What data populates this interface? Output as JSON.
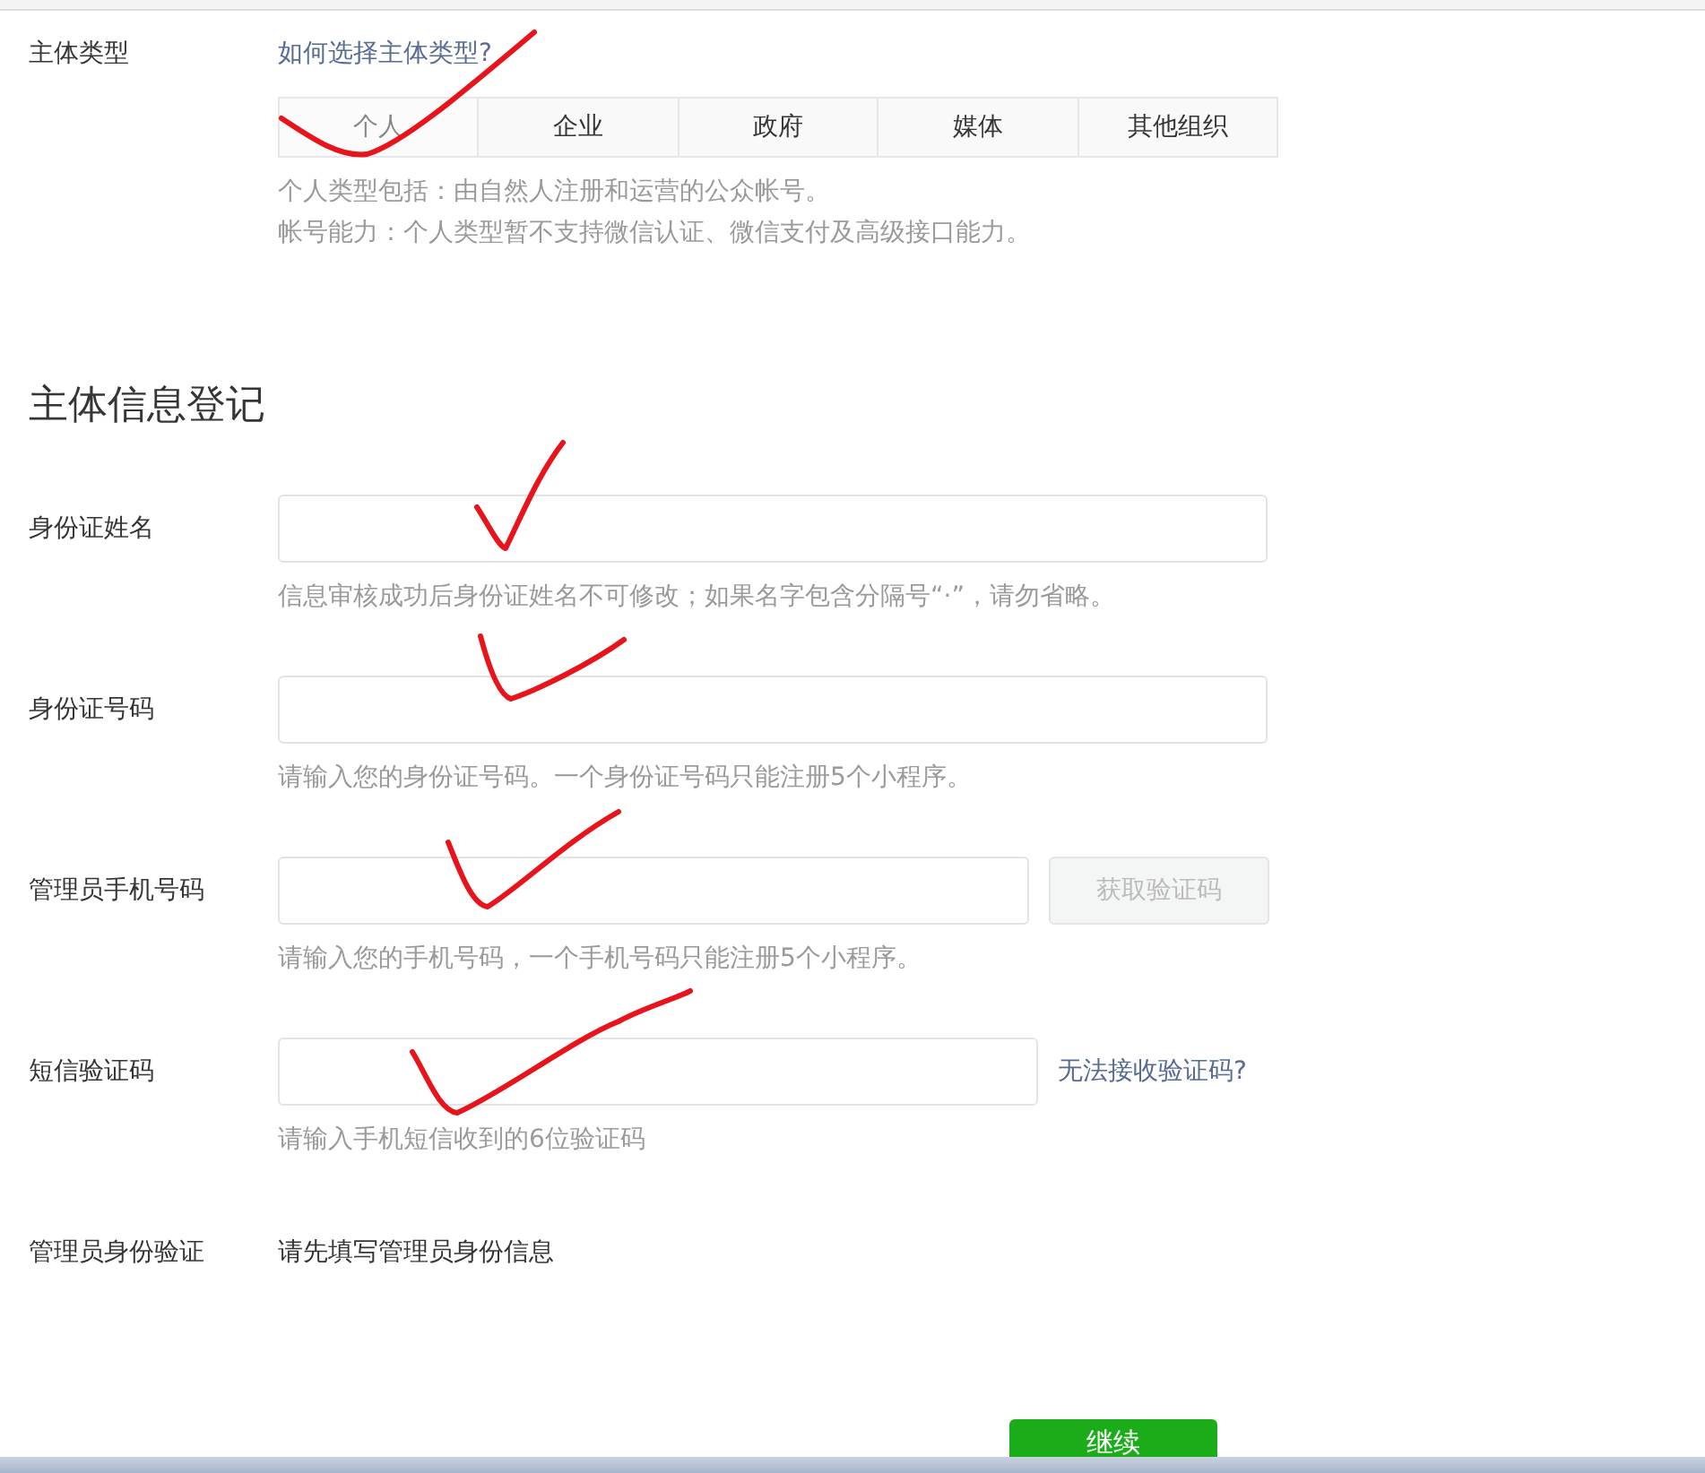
{
  "subject_type": {
    "label": "主体类型",
    "help_link": "如何选择主体类型?",
    "tabs": [
      {
        "label": "个人",
        "selected": true
      },
      {
        "label": "企业",
        "selected": false
      },
      {
        "label": "政府",
        "selected": false
      },
      {
        "label": "媒体",
        "selected": false
      },
      {
        "label": "其他组织",
        "selected": false
      }
    ],
    "notes": [
      "个人类型包括：由自然人注册和运营的公众帐号。",
      "帐号能力：个人类型暂不支持微信认证、微信支付及高级接口能力。"
    ]
  },
  "section_title": "主体信息登记",
  "fields": [
    {
      "kind": "input",
      "label": "身份证姓名",
      "help": "信息审核成功后身份证姓名不可修改；如果名字包含分隔号“·”，请勿省略。"
    },
    {
      "kind": "input",
      "label": "身份证号码",
      "help": "请输入您的身份证号码。一个身份证号码只能注册5个小程序。"
    },
    {
      "kind": "input_button",
      "label": "管理员手机号码",
      "button": {
        "label": "获取验证码",
        "disabled": true
      },
      "help": "请输入您的手机号码，一个手机号码只能注册5个小程序。"
    },
    {
      "kind": "input_link",
      "label": "短信验证码",
      "link": "无法接收验证码?",
      "help": "请输入手机短信收到的6位验证码"
    },
    {
      "kind": "text",
      "label": "管理员身份验证",
      "value": "请先填写管理员身份信息"
    }
  ],
  "continue_button": "继续"
}
